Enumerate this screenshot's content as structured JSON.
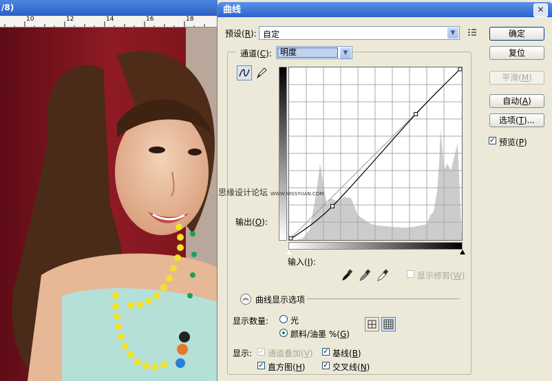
{
  "document": {
    "title_fragment": "/8)",
    "ruler_ticks": [
      "10",
      "12",
      "14",
      "16",
      "18"
    ]
  },
  "dialog": {
    "title": "曲线",
    "close_glyph": "✕",
    "preset_label": "预设(",
    "preset_key": "R",
    "preset_label_end": "):",
    "preset_value": "自定",
    "channel_label": "通道(",
    "channel_key": "C",
    "channel_label_end": "):",
    "channel_value": "明度",
    "output_label": "输出(",
    "output_key": "O",
    "output_label_end": "):",
    "input_label": "输入(",
    "input_key": "I",
    "input_label_end": "):",
    "show_clipping_label": "显示修剪(",
    "show_clipping_key": "W",
    "show_clipping_end": ")",
    "display_options_title": "曲线显示选项",
    "show_amount_label": "显示数量:",
    "radio_light_label": "光",
    "radio_pigment_label": "颜料/油墨 %(",
    "radio_pigment_key": "G",
    "radio_pigment_end": ")",
    "display_label": "显示:",
    "channel_overlay_label": "通道叠加(",
    "channel_overlay_key": "V",
    "channel_overlay_end": ")",
    "baseline_label": "基线(",
    "baseline_key": "B",
    "baseline_end": ")",
    "histogram_label": "直方图(",
    "histogram_key": "H",
    "histogram_end": ")",
    "intersection_label": "交叉线(",
    "intersection_key": "N",
    "intersection_end": ")",
    "watermark_text": "思缘设计论坛",
    "watermark_url": "WWW.MISSYUAN.COM"
  },
  "buttons": {
    "ok": "确定",
    "reset": "复位",
    "smooth_text": "平滑(",
    "smooth_key": "M",
    "smooth_end": ")",
    "auto_text": "自动(",
    "auto_key": "A",
    "auto_end": ")",
    "options_text": "选项(",
    "options_key": "T",
    "options_end": ")...",
    "preview_text": "预览(",
    "preview_key": "P",
    "preview_end": ")"
  },
  "state": {
    "preview_checked": true,
    "show_clipping_checked": false,
    "channel_overlay_checked": true,
    "baseline_checked": true,
    "histogram_checked": true,
    "intersection_checked": true,
    "radio_selected": "pigment",
    "grid": "detailed"
  },
  "curve": {
    "control_points": [
      [
        0,
        0
      ],
      [
        64,
        50
      ],
      [
        187,
        186
      ],
      [
        255,
        255
      ]
    ]
  },
  "colors": {
    "title_bar": "#2c64cf",
    "dialog_bg": "#ece9d8",
    "check_green": "#1b8a1b"
  },
  "icons": {
    "curve_tool": "curve-tool-icon",
    "pencil_tool": "pencil-icon",
    "preset_menu": "menu-list-icon",
    "eyedroppers": [
      "black-eyedropper-icon",
      "gray-eyedropper-icon",
      "white-eyedropper-icon"
    ]
  }
}
